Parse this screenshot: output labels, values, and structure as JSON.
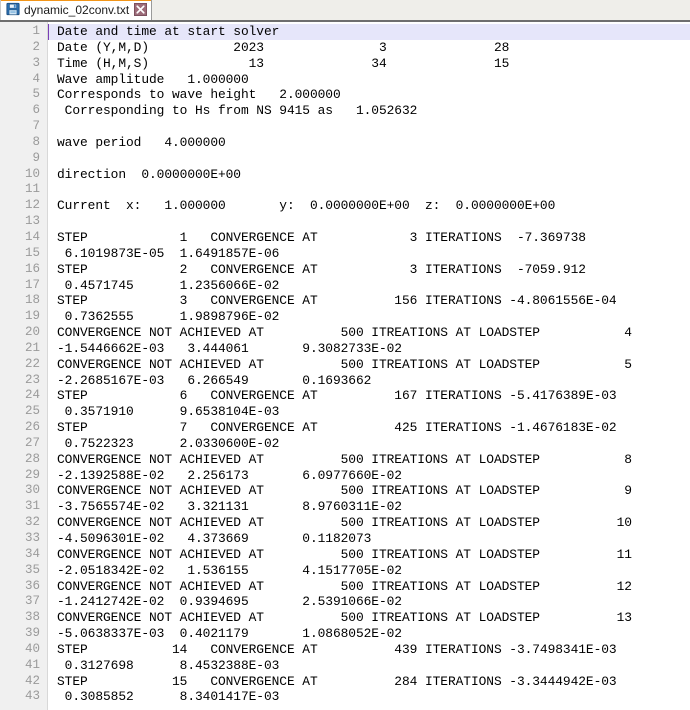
{
  "window": {
    "title": "dynamic_02conv.txt"
  },
  "tabbar": {
    "active_accent_color": "#f29518",
    "tabs": [
      {
        "label": "dynamic_02conv.txt",
        "icon": "save-floppy-icon",
        "close_icon": "close-icon",
        "active": true,
        "modified": false
      }
    ]
  },
  "editor": {
    "current_line": 1,
    "current_line_highlight_color": "#e6e6fa",
    "caret_color": "#7a3fb5",
    "gutter_background": "#f0f0f0",
    "gutter_text_color": "#9a9a9a",
    "text_color": "#000000",
    "background": "#ffffff",
    "first_visible_line": 1,
    "last_visible_line": 43,
    "lines": [
      {
        "n": 1,
        "text": "Date and time at start solver"
      },
      {
        "n": 2,
        "text": "Date (Y,M,D)           2023               3              28"
      },
      {
        "n": 3,
        "text": "Time (H,M,S)             13              34              15"
      },
      {
        "n": 4,
        "text": "Wave amplitude   1.000000"
      },
      {
        "n": 5,
        "text": "Corresponds to wave height   2.000000"
      },
      {
        "n": 6,
        "text": " Corresponding to Hs from NS 9415 as   1.052632"
      },
      {
        "n": 7,
        "text": ""
      },
      {
        "n": 8,
        "text": "wave period   4.000000"
      },
      {
        "n": 9,
        "text": ""
      },
      {
        "n": 10,
        "text": "direction  0.0000000E+00"
      },
      {
        "n": 11,
        "text": ""
      },
      {
        "n": 12,
        "text": "Current  x:   1.000000       y:  0.0000000E+00  z:  0.0000000E+00"
      },
      {
        "n": 13,
        "text": ""
      },
      {
        "n": 14,
        "text": "STEP            1   CONVERGENCE AT            3 ITERATIONS  -7.369738"
      },
      {
        "n": 15,
        "text": " 6.1019873E-05  1.6491857E-06"
      },
      {
        "n": 16,
        "text": "STEP            2   CONVERGENCE AT            3 ITERATIONS  -7059.912"
      },
      {
        "n": 17,
        "text": " 0.4571745      1.2356066E-02"
      },
      {
        "n": 18,
        "text": "STEP            3   CONVERGENCE AT          156 ITERATIONS -4.8061556E-04"
      },
      {
        "n": 19,
        "text": " 0.7362555      1.9898796E-02"
      },
      {
        "n": 20,
        "text": "CONVERGENCE NOT ACHIEVED AT          500 ITREATIONS AT LOADSTEP           4"
      },
      {
        "n": 21,
        "text": "-1.5446662E-03   3.444061       9.3082733E-02"
      },
      {
        "n": 22,
        "text": "CONVERGENCE NOT ACHIEVED AT          500 ITREATIONS AT LOADSTEP           5"
      },
      {
        "n": 23,
        "text": "-2.2685167E-03   6.266549       0.1693662"
      },
      {
        "n": 24,
        "text": "STEP            6   CONVERGENCE AT          167 ITERATIONS -5.4176389E-03"
      },
      {
        "n": 25,
        "text": " 0.3571910      9.6538104E-03"
      },
      {
        "n": 26,
        "text": "STEP            7   CONVERGENCE AT          425 ITERATIONS -1.4676183E-02"
      },
      {
        "n": 27,
        "text": " 0.7522323      2.0330600E-02"
      },
      {
        "n": 28,
        "text": "CONVERGENCE NOT ACHIEVED AT          500 ITREATIONS AT LOADSTEP           8"
      },
      {
        "n": 29,
        "text": "-2.1392588E-02   2.256173       6.0977660E-02"
      },
      {
        "n": 30,
        "text": "CONVERGENCE NOT ACHIEVED AT          500 ITREATIONS AT LOADSTEP           9"
      },
      {
        "n": 31,
        "text": "-3.7565574E-02   3.321131       8.9760311E-02"
      },
      {
        "n": 32,
        "text": "CONVERGENCE NOT ACHIEVED AT          500 ITREATIONS AT LOADSTEP          10"
      },
      {
        "n": 33,
        "text": "-4.5096301E-02   4.373669       0.1182073"
      },
      {
        "n": 34,
        "text": "CONVERGENCE NOT ACHIEVED AT          500 ITREATIONS AT LOADSTEP          11"
      },
      {
        "n": 35,
        "text": "-2.0518342E-02   1.536155       4.1517705E-02"
      },
      {
        "n": 36,
        "text": "CONVERGENCE NOT ACHIEVED AT          500 ITREATIONS AT LOADSTEP          12"
      },
      {
        "n": 37,
        "text": "-1.2412742E-02  0.9394695       2.5391066E-02"
      },
      {
        "n": 38,
        "text": "CONVERGENCE NOT ACHIEVED AT          500 ITREATIONS AT LOADSTEP          13"
      },
      {
        "n": 39,
        "text": "-5.0638337E-03  0.4021179       1.0868052E-02"
      },
      {
        "n": 40,
        "text": "STEP           14   CONVERGENCE AT          439 ITERATIONS -3.7498341E-03"
      },
      {
        "n": 41,
        "text": " 0.3127698      8.4532388E-03"
      },
      {
        "n": 42,
        "text": "STEP           15   CONVERGENCE AT          284 ITERATIONS -3.3444942E-03"
      },
      {
        "n": 43,
        "text": " 0.3085852      8.3401417E-03"
      }
    ]
  }
}
